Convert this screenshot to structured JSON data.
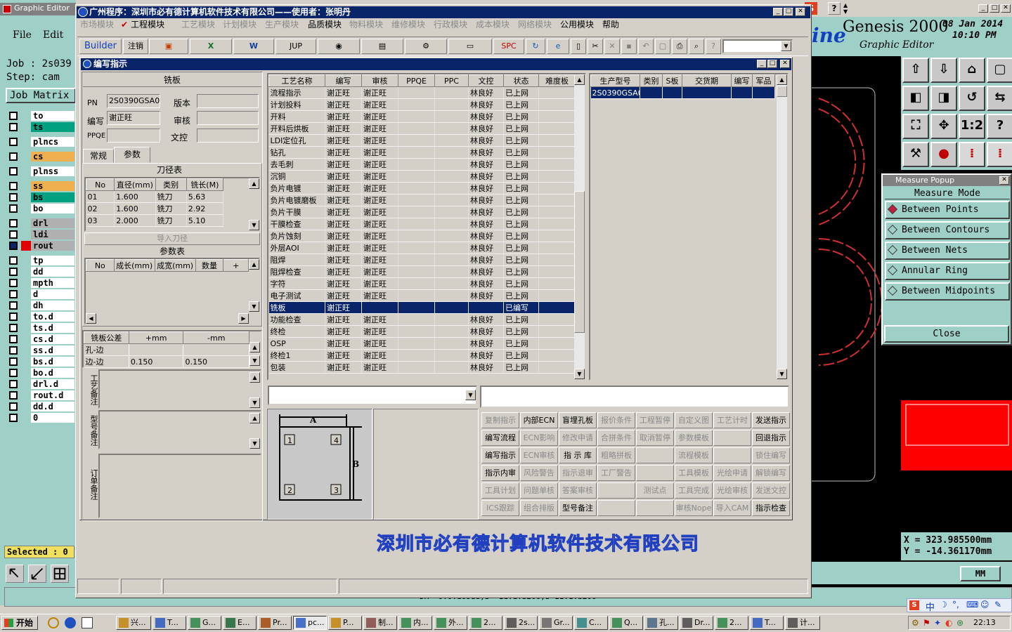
{
  "genesis": {
    "window_title": "Graphic Editor",
    "menu": [
      "File",
      "Edit"
    ],
    "job_label": "Job : 2s039",
    "step_label": "Step: cam",
    "job_matrix_label": "Job Matrix",
    "product_tail": "ine",
    "product_name": "Genesis 2000",
    "product_sub": "Graphic Editor",
    "date": "08 Jan 2014",
    "time": "10:10 PM",
    "layers": [
      {
        "name": "to",
        "color": "#ffffff"
      },
      {
        "name": "ts",
        "color": "#00a080"
      },
      {
        "name": "plncs",
        "color": "#ffffff"
      },
      {
        "name": "cs",
        "color": "#f0b050"
      },
      {
        "name": "plnss",
        "color": "#ffffff"
      },
      {
        "name": "ss",
        "color": "#f0b050"
      },
      {
        "name": "bs",
        "color": "#00a080"
      },
      {
        "name": "bo",
        "color": "#ffffff"
      },
      {
        "name": "drl",
        "color": "#b0b0b0"
      },
      {
        "name": "ldi",
        "color": "#b0b0b0"
      },
      {
        "name": "rout",
        "color": "#b0b0b0"
      },
      {
        "name": "tp",
        "color": "#ffffff"
      },
      {
        "name": "dd",
        "color": "#ffffff"
      },
      {
        "name": "mpth",
        "color": "#ffffff"
      },
      {
        "name": "d",
        "color": "#ffffff"
      },
      {
        "name": "dh",
        "color": "#ffffff"
      },
      {
        "name": "to.d",
        "color": "#ffffff"
      },
      {
        "name": "ts.d",
        "color": "#ffffff"
      },
      {
        "name": "cs.d",
        "color": "#ffffff"
      },
      {
        "name": "ss.d",
        "color": "#ffffff"
      },
      {
        "name": "bs.d",
        "color": "#ffffff"
      },
      {
        "name": "bo.d",
        "color": "#ffffff"
      },
      {
        "name": "drl.d",
        "color": "#ffffff"
      },
      {
        "name": "rout.d",
        "color": "#ffffff"
      },
      {
        "name": "dd.d",
        "color": "#ffffff"
      },
      {
        "name": "0",
        "color": "#ffffff"
      }
    ],
    "selected_label": "Selected : 0",
    "coord_x": "X  = 323.985500mm",
    "coord_y": "Y  = -14.361170mm",
    "units": "MM",
    "status_text": "DR=-0.0.109ud,b=-11.1.b200,b-11.1.b200"
  },
  "measure_popup": {
    "title": "Measure Popup",
    "mode_label": "Measure Mode",
    "options": [
      "Between Points",
      "Between Contours",
      "Between Nets",
      "Annular Ring",
      "Between Midpoints"
    ],
    "selected_index": 0,
    "close_label": "Close"
  },
  "main_app": {
    "title": "广州程序：深圳市必有德计算机软件技术有限公司——使用者：张明丹",
    "menu": [
      {
        "label": "市场模块",
        "enabled": false
      },
      {
        "label": "工程模块",
        "enabled": true,
        "checked": true
      },
      {
        "label": "工艺模块",
        "enabled": false
      },
      {
        "label": "计划模块",
        "enabled": false
      },
      {
        "label": "生产模块",
        "enabled": false
      },
      {
        "label": "品质模块",
        "enabled": true
      },
      {
        "label": "物料模块",
        "enabled": false
      },
      {
        "label": "维修模块",
        "enabled": false
      },
      {
        "label": "行政模块",
        "enabled": false
      },
      {
        "label": "成本模块",
        "enabled": false
      },
      {
        "label": "网络模块",
        "enabled": false
      },
      {
        "label": "公用模块",
        "enabled": true
      },
      {
        "label": "帮助",
        "enabled": true
      }
    ],
    "toolbar": {
      "builder": "Builder",
      "logout": "注销",
      "jup": "JUP",
      "spc": "SPC"
    },
    "company_watermark": "深圳市必有德计算机软件技术有限公司"
  },
  "dialog": {
    "title": "编写指示",
    "section_title": "铣板",
    "fields": {
      "pn_label": "PN",
      "pn_value": "2S0390GSA0",
      "version_label": "版本",
      "version_value": "",
      "writer_label": "编写",
      "writer_value": "谢正旺",
      "review_label": "审核",
      "review_value": "",
      "ppqe_label": "PPQE",
      "ppqe_value": "",
      "doc_label": "文控",
      "doc_value": ""
    },
    "tabs": [
      "常规",
      "参数"
    ],
    "active_tab": 1,
    "tool_table": {
      "title": "刀径表",
      "headers": [
        "No",
        "直径(mm)",
        "类别",
        "铣长(M)"
      ],
      "rows": [
        [
          "01",
          "1.600",
          "铣刀",
          "5.63"
        ],
        [
          "02",
          "1.600",
          "铣刀",
          "2.92"
        ],
        [
          "03",
          "2.000",
          "铣刀",
          "5.10"
        ]
      ]
    },
    "import_tool_label": "导入刀径",
    "param_table": {
      "title": "参数表",
      "headers": [
        "No",
        "成长(mm)",
        "成宽(mm)",
        "数量",
        "+"
      ]
    },
    "tolerance_table": {
      "headers": [
        "铣板公差",
        "+mm",
        "-mm"
      ],
      "rows": [
        [
          "孔-边",
          "",
          ""
        ],
        [
          "边-边",
          "0.150",
          "0.150"
        ]
      ]
    },
    "notes": {
      "process": "工艺备注",
      "model": "型号备注",
      "order": "订单备注"
    },
    "process_table": {
      "headers": [
        "工艺名称",
        "编写",
        "审核",
        "PPQE",
        "PPC",
        "文控",
        "状态",
        "难度板"
      ],
      "rows": [
        [
          "流程指示",
          "谢正旺",
          "谢正旺",
          "",
          "",
          "林良好",
          "已上网",
          ""
        ],
        [
          "计划投料",
          "谢正旺",
          "谢正旺",
          "",
          "",
          "林良好",
          "已上网",
          ""
        ],
        [
          "开料",
          "谢正旺",
          "谢正旺",
          "",
          "",
          "林良好",
          "已上网",
          ""
        ],
        [
          "开料后烘板",
          "谢正旺",
          "谢正旺",
          "",
          "",
          "林良好",
          "已上网",
          ""
        ],
        [
          "LDI定位孔",
          "谢正旺",
          "谢正旺",
          "",
          "",
          "林良好",
          "已上网",
          ""
        ],
        [
          "钻孔",
          "谢正旺",
          "谢正旺",
          "",
          "",
          "林良好",
          "已上网",
          ""
        ],
        [
          "去毛刺",
          "谢正旺",
          "谢正旺",
          "",
          "",
          "林良好",
          "已上网",
          ""
        ],
        [
          "沉铜",
          "谢正旺",
          "谢正旺",
          "",
          "",
          "林良好",
          "已上网",
          ""
        ],
        [
          "负片电镀",
          "谢正旺",
          "谢正旺",
          "",
          "",
          "林良好",
          "已上网",
          ""
        ],
        [
          "负片电镀磨板",
          "谢正旺",
          "谢正旺",
          "",
          "",
          "林良好",
          "已上网",
          ""
        ],
        [
          "负片干膜",
          "谢正旺",
          "谢正旺",
          "",
          "",
          "林良好",
          "已上网",
          ""
        ],
        [
          "干膜检查",
          "谢正旺",
          "谢正旺",
          "",
          "",
          "林良好",
          "已上网",
          ""
        ],
        [
          "负片蚀刻",
          "谢正旺",
          "谢正旺",
          "",
          "",
          "林良好",
          "已上网",
          ""
        ],
        [
          "外层AOI",
          "谢正旺",
          "谢正旺",
          "",
          "",
          "林良好",
          "已上网",
          ""
        ],
        [
          "阻焊",
          "谢正旺",
          "谢正旺",
          "",
          "",
          "林良好",
          "已上网",
          ""
        ],
        [
          "阻焊检查",
          "谢正旺",
          "谢正旺",
          "",
          "",
          "林良好",
          "已上网",
          ""
        ],
        [
          "字符",
          "谢正旺",
          "谢正旺",
          "",
          "",
          "林良好",
          "已上网",
          ""
        ],
        [
          "电子测试",
          "谢正旺",
          "谢正旺",
          "",
          "",
          "林良好",
          "已上网",
          ""
        ],
        [
          "铣板",
          "谢正旺",
          "",
          "",
          "",
          "",
          "已编写",
          ""
        ],
        [
          "功能检查",
          "谢正旺",
          "谢正旺",
          "",
          "",
          "林良好",
          "已上网",
          ""
        ],
        [
          "终检",
          "谢正旺",
          "谢正旺",
          "",
          "",
          "林良好",
          "已上网",
          ""
        ],
        [
          "OSP",
          "谢正旺",
          "谢正旺",
          "",
          "",
          "林良好",
          "已上网",
          ""
        ],
        [
          "终检1",
          "谢正旺",
          "谢正旺",
          "",
          "",
          "林良好",
          "已上网",
          ""
        ],
        [
          "包装",
          "谢正旺",
          "谢正旺",
          "",
          "",
          "林良好",
          "已上网",
          ""
        ]
      ],
      "selected_row": 18
    },
    "model_table": {
      "headers": [
        "生产型号",
        "类别",
        "S板",
        "交货期",
        "编写",
        "军品"
      ],
      "rows": [
        [
          "2S0390GSA0",
          "",
          "",
          "",
          "",
          ""
        ]
      ]
    },
    "diagram": {
      "label_a": "A",
      "label_b": "B",
      "corners": [
        "1",
        "4",
        "2",
        "3"
      ]
    },
    "action_buttons": [
      {
        "label": "复制指示",
        "enabled": false
      },
      {
        "label": "内部ECN",
        "enabled": true
      },
      {
        "label": "盲埋孔板",
        "enabled": true
      },
      {
        "label": "报价条件",
        "enabled": false
      },
      {
        "label": "工程暂停",
        "enabled": false
      },
      {
        "label": "自定义图",
        "enabled": false
      },
      {
        "label": "工艺计时",
        "enabled": false
      },
      {
        "label": "发送指示",
        "enabled": true
      },
      {
        "label": "编写流程",
        "enabled": true
      },
      {
        "label": "ECN影响",
        "enabled": false
      },
      {
        "label": "修改申请",
        "enabled": false
      },
      {
        "label": "合拼条件",
        "enabled": false
      },
      {
        "label": "取消暂停",
        "enabled": false
      },
      {
        "label": "参数模板",
        "enabled": false
      },
      {
        "label": "",
        "enabled": false
      },
      {
        "label": "回退指示",
        "enabled": true
      },
      {
        "label": "编写指示",
        "enabled": true
      },
      {
        "label": "ECN审核",
        "enabled": false
      },
      {
        "label": "指 示 库",
        "enabled": true
      },
      {
        "label": "粗略拼板",
        "enabled": false
      },
      {
        "label": "",
        "enabled": false
      },
      {
        "label": "流程模板",
        "enabled": false
      },
      {
        "label": "",
        "enabled": false
      },
      {
        "label": "锁住编写",
        "enabled": false
      },
      {
        "label": "指示内审",
        "enabled": true
      },
      {
        "label": "风险警告",
        "enabled": false
      },
      {
        "label": "指示退审",
        "enabled": false
      },
      {
        "label": "工厂警告",
        "enabled": false
      },
      {
        "label": "",
        "enabled": false
      },
      {
        "label": "工具模板",
        "enabled": false
      },
      {
        "label": "光绘申请",
        "enabled": false
      },
      {
        "label": "解锁编写",
        "enabled": false
      },
      {
        "label": "工具计划",
        "enabled": false
      },
      {
        "label": "问题单核",
        "enabled": false
      },
      {
        "label": "答案审核",
        "enabled": false
      },
      {
        "label": "",
        "enabled": false
      },
      {
        "label": "测试点",
        "enabled": false
      },
      {
        "label": "工具完成",
        "enabled": false
      },
      {
        "label": "光绘审核",
        "enabled": false
      },
      {
        "label": "发送文控",
        "enabled": false
      },
      {
        "label": "ICS跟踪",
        "enabled": false
      },
      {
        "label": "组合排版",
        "enabled": false
      },
      {
        "label": "型号备注",
        "enabled": true
      },
      {
        "label": "",
        "enabled": false
      },
      {
        "label": "",
        "enabled": false
      },
      {
        "label": "审核Nope",
        "enabled": false
      },
      {
        "label": "导入CAM",
        "enabled": false
      },
      {
        "label": "指示检查",
        "enabled": true
      }
    ]
  },
  "taskbar": {
    "start": "开始",
    "tasks": [
      "兴...",
      "T...",
      "G...",
      "E...",
      "Pr...",
      "pc...",
      "P...",
      "制...",
      "内...",
      "外...",
      "2...",
      "2s...",
      "Gr...",
      "C...",
      "Q...",
      "孔...",
      "Dr...",
      "2...",
      "T...",
      "计..."
    ],
    "clock": "22:13",
    "ime_text": "中"
  }
}
